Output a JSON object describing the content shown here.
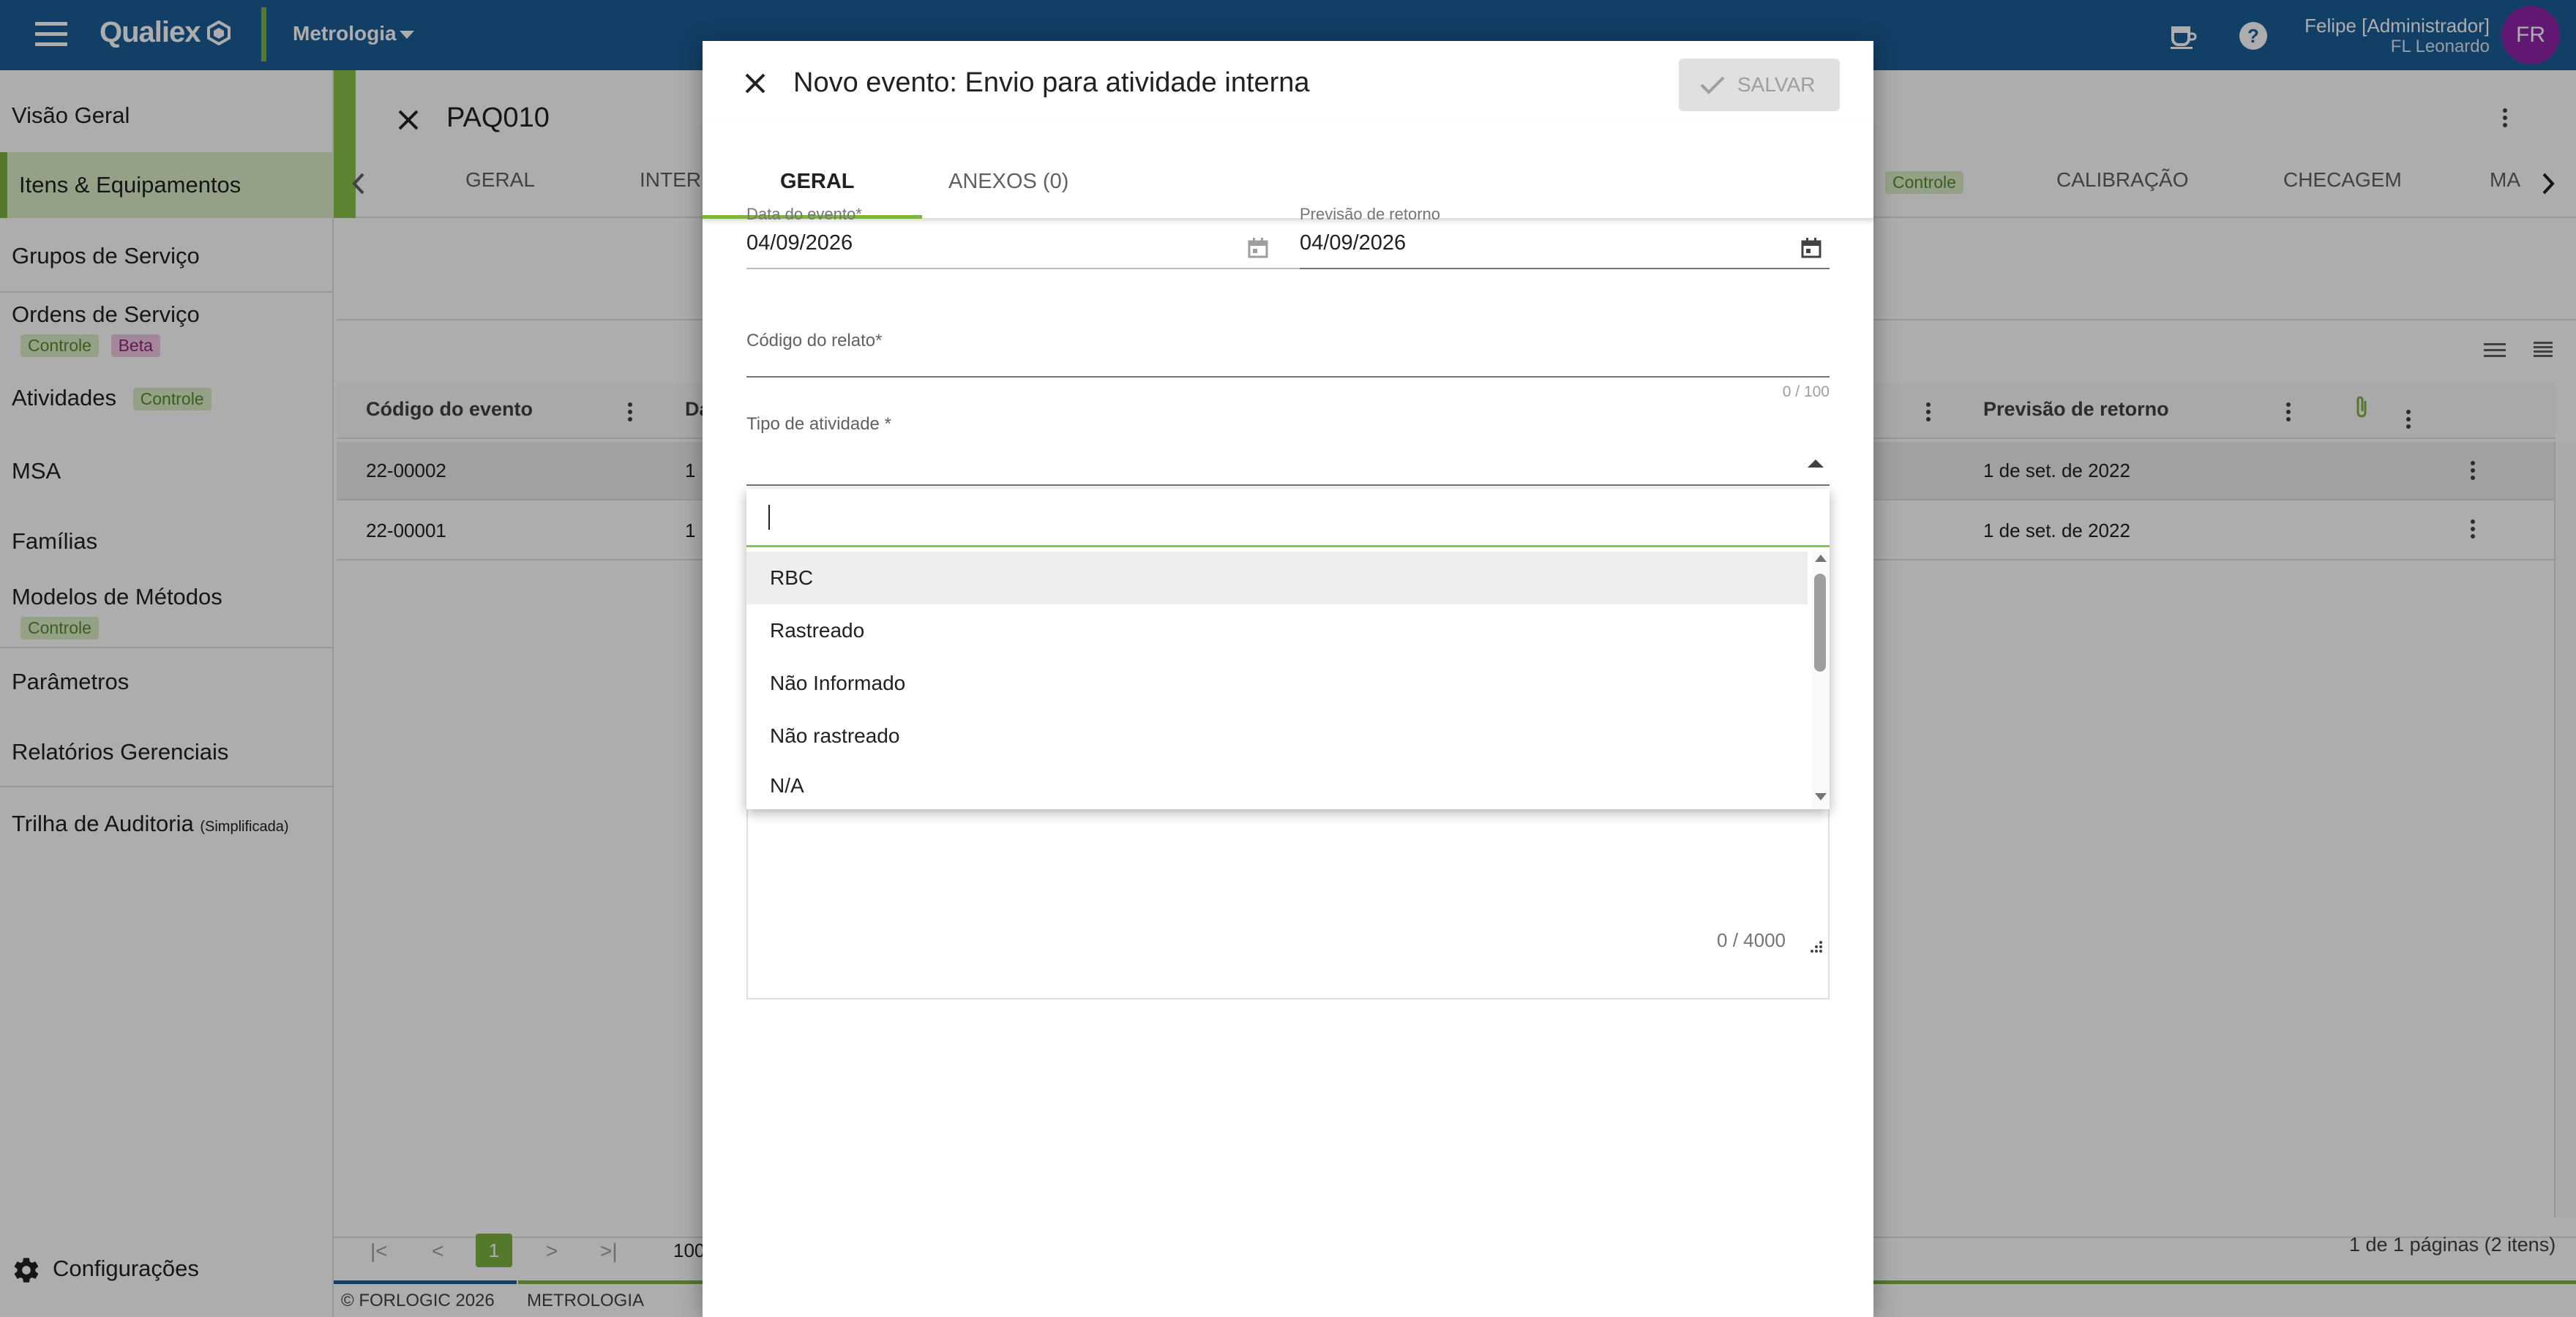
{
  "topbar": {
    "logo": "Qualiex",
    "module": "Metrologia",
    "user_name": "Felipe [Administrador]",
    "user_org": "FL Leonardo",
    "avatar_initials": "FR",
    "brand_color": "#1b5e96",
    "accent_color": "#7cb342"
  },
  "sidebar": {
    "items": [
      {
        "label": "Visão Geral"
      },
      {
        "label": "Itens & Equipamentos"
      },
      {
        "label": "Grupos de Serviço"
      },
      {
        "label": "Ordens de Serviço",
        "tags": [
          "Controle",
          "Beta"
        ]
      },
      {
        "label": "Atividades",
        "tags": [
          "Controle"
        ]
      },
      {
        "label": "MSA"
      },
      {
        "label": "Famílias"
      },
      {
        "label": "Modelos de Métodos",
        "tags": [
          "Controle"
        ]
      },
      {
        "label": "Parâmetros"
      },
      {
        "label": "Relatórios Gerenciais"
      },
      {
        "label": "Trilha de Auditoria",
        "suffix": "(Simplificada)"
      }
    ],
    "settings_label": "Configurações"
  },
  "main": {
    "title": "PAQ010",
    "tabs": [
      "GERAL",
      "INTER",
      "Controle",
      "CALIBRAÇÃO",
      "CHECAGEM",
      "MA"
    ],
    "columns": [
      "Código do evento",
      "Da",
      "Previsão de retorno"
    ],
    "rows": [
      {
        "code": "22-00002",
        "date_part": "1",
        "return": "1 de set. de 2022"
      },
      {
        "code": "22-00001",
        "date_part": "1",
        "return": "1 de set. de 2022"
      }
    ],
    "pagination": {
      "current_page": "1",
      "page_size_partial": "100",
      "summary": "1 de 1 páginas (2 itens)"
    },
    "footer": {
      "copyright": "© FORLOGIC 2026",
      "module": "METROLOGIA"
    }
  },
  "dialog": {
    "title": "Novo evento: Envio para atividade interna",
    "save_label": "SALVAR",
    "tabs": [
      "GERAL",
      "ANEXOS (0)"
    ],
    "event_date_label": "Data do evento*",
    "event_date_value": "04/09/2026",
    "return_date_label": "Previsão de retorno",
    "return_date_value": "04/09/2026",
    "report_code_label": "Código do relato*",
    "report_code_counter": "0 / 100",
    "activity_type_label": "Tipo de atividade *",
    "textarea_counter": "0 / 4000"
  },
  "dropdown": {
    "search_value": "",
    "options": [
      "RBC",
      "Rastreado",
      "Não Informado",
      "Não rastreado",
      "N/A"
    ]
  }
}
